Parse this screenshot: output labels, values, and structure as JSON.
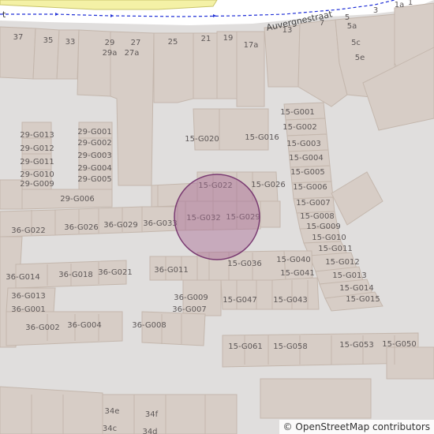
{
  "map": {
    "street_name": "Auvergnestraat",
    "street_name_left_fragment": "t",
    "marker": {
      "fill": "#a86a95",
      "stroke": "#7a3b72"
    },
    "colors": {
      "background": "#e0dedd",
      "building": "#d7cdc6",
      "building_stroke": "#c4b7ad",
      "road": "#ffffff",
      "boundary": "#1f2fd6",
      "park": "#f4f1a6"
    },
    "house_numbers": [
      "37",
      "35",
      "33",
      "29",
      "29a",
      "27",
      "27a",
      "25",
      "21",
      "19",
      "17a",
      "13",
      "7",
      "5",
      "5a",
      "5c",
      "5e",
      "3",
      "1a",
      "1",
      "34e",
      "34f",
      "34c",
      "34d"
    ],
    "unit_labels": [
      "29-G013",
      "29-G012",
      "29-G011",
      "29-G010",
      "29-G009",
      "29-G001",
      "29-G002",
      "29-G003",
      "29-G004",
      "29-G005",
      "29-G006",
      "15-G001",
      "15-G002",
      "15-G003",
      "15-G004",
      "15-G005",
      "15-G006",
      "15-G007",
      "15-G008",
      "15-G009",
      "15-G010",
      "15-G011",
      "15-G012",
      "15-G013",
      "15-G014",
      "15-G015",
      "15-G020",
      "15-G016",
      "15-G022",
      "15-G026",
      "15-G032",
      "15-G029",
      "15-G036",
      "15-G040",
      "15-G041",
      "15-G047",
      "15-G043",
      "15-G061",
      "15-G058",
      "15-G053",
      "15-G050",
      "36-G022",
      "36-G026",
      "36-G029",
      "36-G033",
      "36-G014",
      "36-G018",
      "36-G021",
      "36-G011",
      "36-G013",
      "36-G001",
      "36-G009",
      "36-G007",
      "36-G002",
      "36-G004",
      "36-G008"
    ]
  },
  "attribution": {
    "symbol": "©",
    "text": "OpenStreetMap contributors"
  }
}
